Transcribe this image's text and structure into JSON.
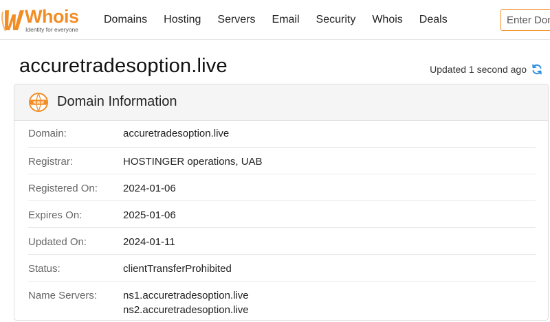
{
  "logo": {
    "name": "Whois",
    "tagline": "Identity for everyone",
    "brand_color": "#f28d25"
  },
  "nav": {
    "items": [
      "Domains",
      "Hosting",
      "Servers",
      "Email",
      "Security",
      "Whois",
      "Deals"
    ]
  },
  "search": {
    "placeholder": "Enter Domain or IP"
  },
  "page": {
    "title": "accuretradesoption.live",
    "updated": "Updated 1 second ago"
  },
  "domain_info": {
    "title": "Domain Information",
    "rows": [
      {
        "label": "Domain:",
        "value": "accuretradesoption.live"
      },
      {
        "label": "Registrar:",
        "value": "HOSTINGER operations, UAB"
      },
      {
        "label": "Registered On:",
        "value": "2024-01-06"
      },
      {
        "label": "Expires On:",
        "value": "2025-01-06"
      },
      {
        "label": "Updated On:",
        "value": "2024-01-11"
      },
      {
        "label": "Status:",
        "value": "clientTransferProhibited"
      },
      {
        "label": "Name Servers:",
        "values": [
          "ns1.accuretradesoption.live",
          "ns2.accuretradesoption.live"
        ]
      }
    ]
  },
  "icons": {
    "logo": "whois-logo-icon",
    "refresh": "refresh-icon",
    "section": "www-globe-icon"
  },
  "colors": {
    "accent": "#f28d25",
    "refresh": "#2f8ee0"
  }
}
